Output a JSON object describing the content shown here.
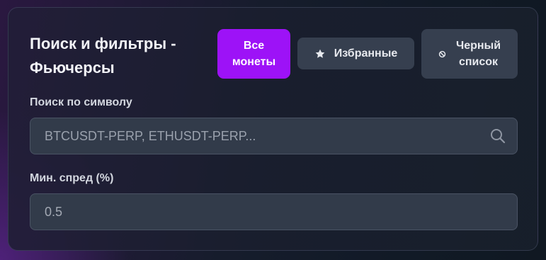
{
  "header": {
    "title_line1": "Поиск и фильтры -",
    "title_line2": "Фьючерсы"
  },
  "filters": {
    "all_coins_line1": "Все",
    "all_coins_line2": "монеты",
    "favorites_label": "Избранные",
    "blacklist_line1": "Черный",
    "blacklist_line2": "список",
    "active_filter": "all_coins"
  },
  "search": {
    "label": "Поиск по символу",
    "placeholder": "BTCUSDT-PERP, ETHUSDT-PERP...",
    "value": ""
  },
  "min_spread": {
    "label": "Мин. спред (%)",
    "value": "0.5"
  },
  "colors": {
    "accent": "#9d12f7",
    "button_bg": "#363f4f",
    "input_bg": "#323b4a"
  },
  "icons": {
    "favorites": "star-icon",
    "blacklist": "ban-icon",
    "search": "search-icon"
  }
}
